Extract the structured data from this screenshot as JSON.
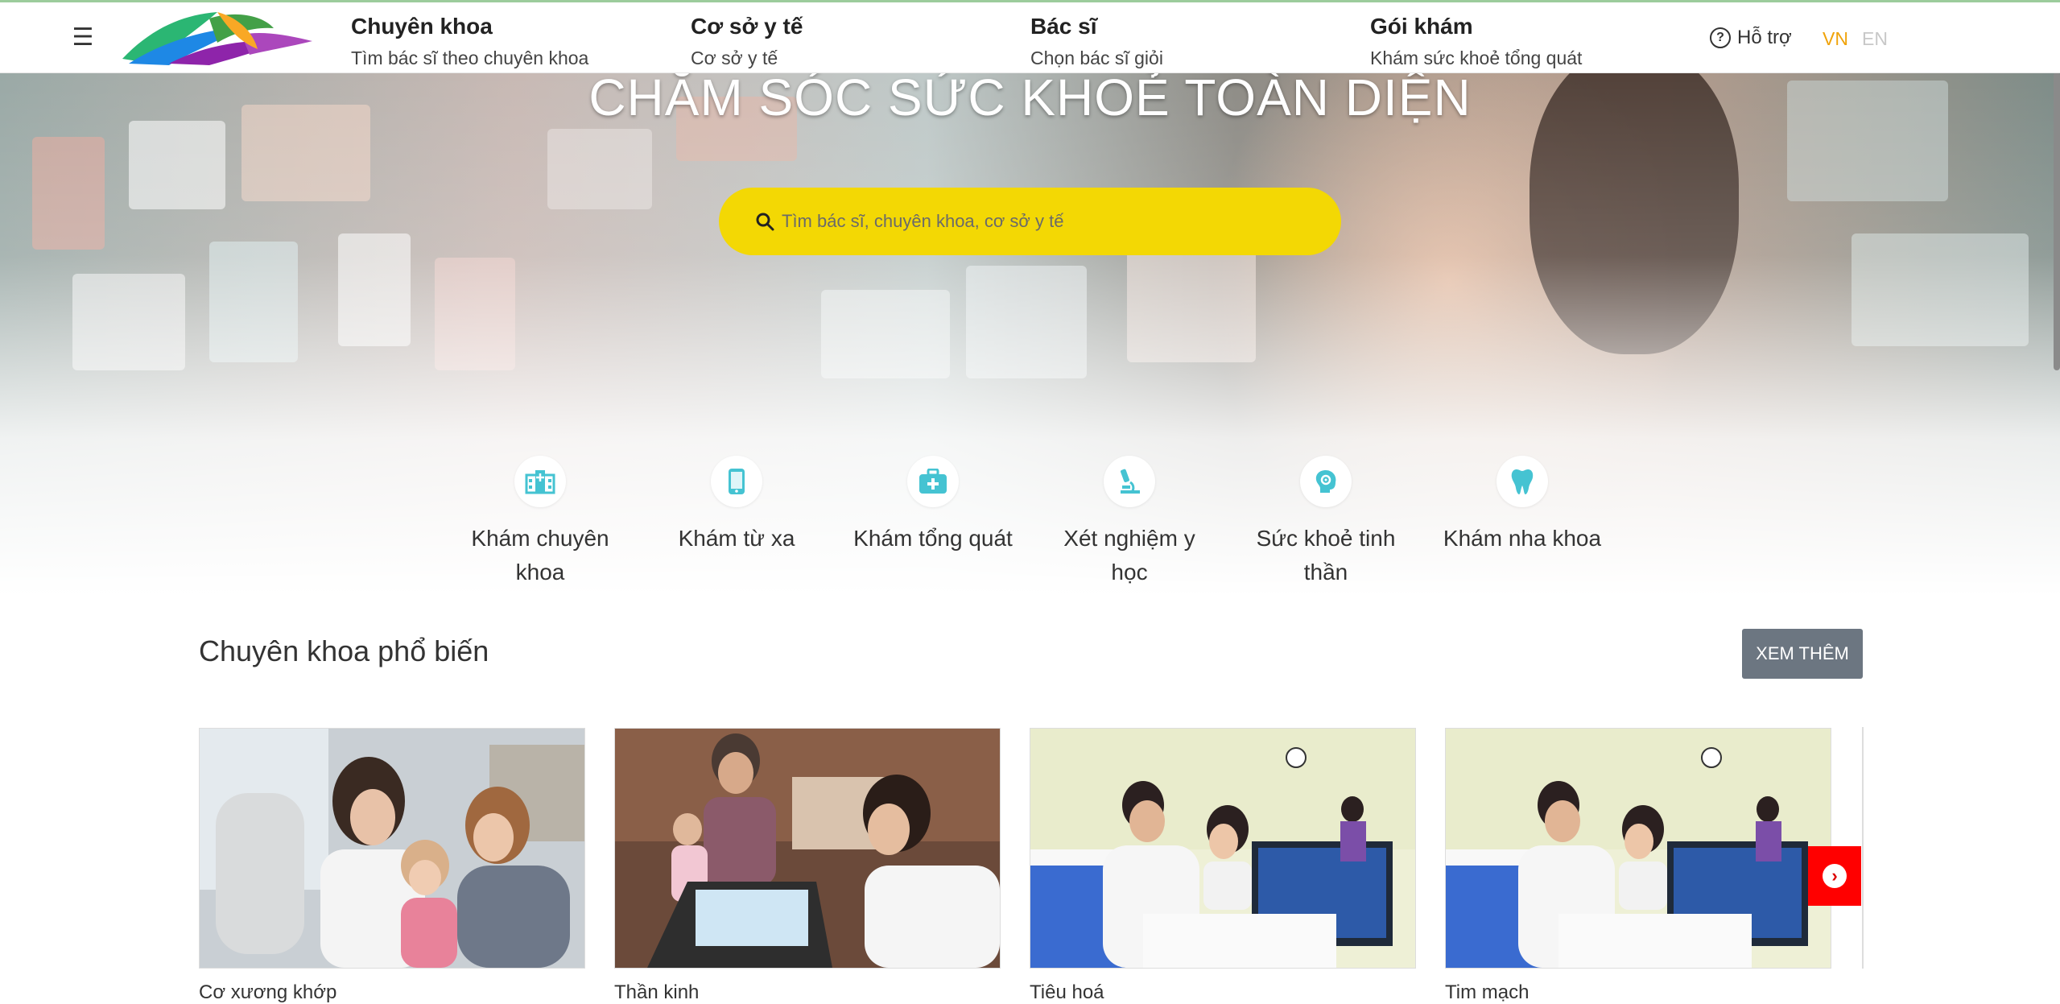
{
  "header": {
    "menu_icon": "hamburger-icon",
    "logo_icon": "bookingcare-logo-icon",
    "nav": [
      {
        "title": "Chuyên khoa",
        "subtitle": "Tìm bác sĩ theo chuyên khoa"
      },
      {
        "title": "Cơ sở y tế",
        "subtitle": "Cơ sở y tế"
      },
      {
        "title": "Bác sĩ",
        "subtitle": "Chọn bác sĩ giỏi"
      },
      {
        "title": "Gói khám",
        "subtitle": "Khám sức khoẻ tổng quát"
      }
    ],
    "support_label": "Hỗ trợ",
    "support_icon": "question-circle-icon",
    "lang_vn": "VN",
    "lang_en": "EN",
    "active_lang_color": "#f0a30a",
    "inactive_lang_color": "#c8c8c8"
  },
  "hero": {
    "title": "CHĂM SÓC SỨC KHOẺ TOÀN DIỆN",
    "search_placeholder": "Tìm bác sĩ, chuyên khoa, cơ sở y tế",
    "search_icon": "search-icon",
    "search_color": "#f3d804",
    "categories": [
      {
        "label": "Khám chuyên khoa",
        "icon": "hospital-icon"
      },
      {
        "label": "Khám từ xa",
        "icon": "mobile-phone-icon"
      },
      {
        "label": "Khám tổng quát",
        "icon": "medical-kit-icon"
      },
      {
        "label": "Xét nghiệm y học",
        "icon": "microscope-icon"
      },
      {
        "label": "Sức khoẻ tinh thần",
        "icon": "brain-icon"
      },
      {
        "label": "Khám nha khoa",
        "icon": "tooth-icon"
      }
    ],
    "icon_color": "#45c3d2"
  },
  "specialty": {
    "title": "Chuyên khoa phổ biến",
    "more_label": "XEM THÊM",
    "next_icon": "chevron-right-icon",
    "cards": [
      {
        "label": "Cơ xương khớp",
        "image": "doctor-with-child-photo"
      },
      {
        "label": "Thần kinh",
        "image": "online-consultation-photo"
      },
      {
        "label": "Tiêu hoá",
        "image": "ent-examination-photo"
      },
      {
        "label": "Tim mạch",
        "image": "ent-examination-photo"
      }
    ]
  }
}
